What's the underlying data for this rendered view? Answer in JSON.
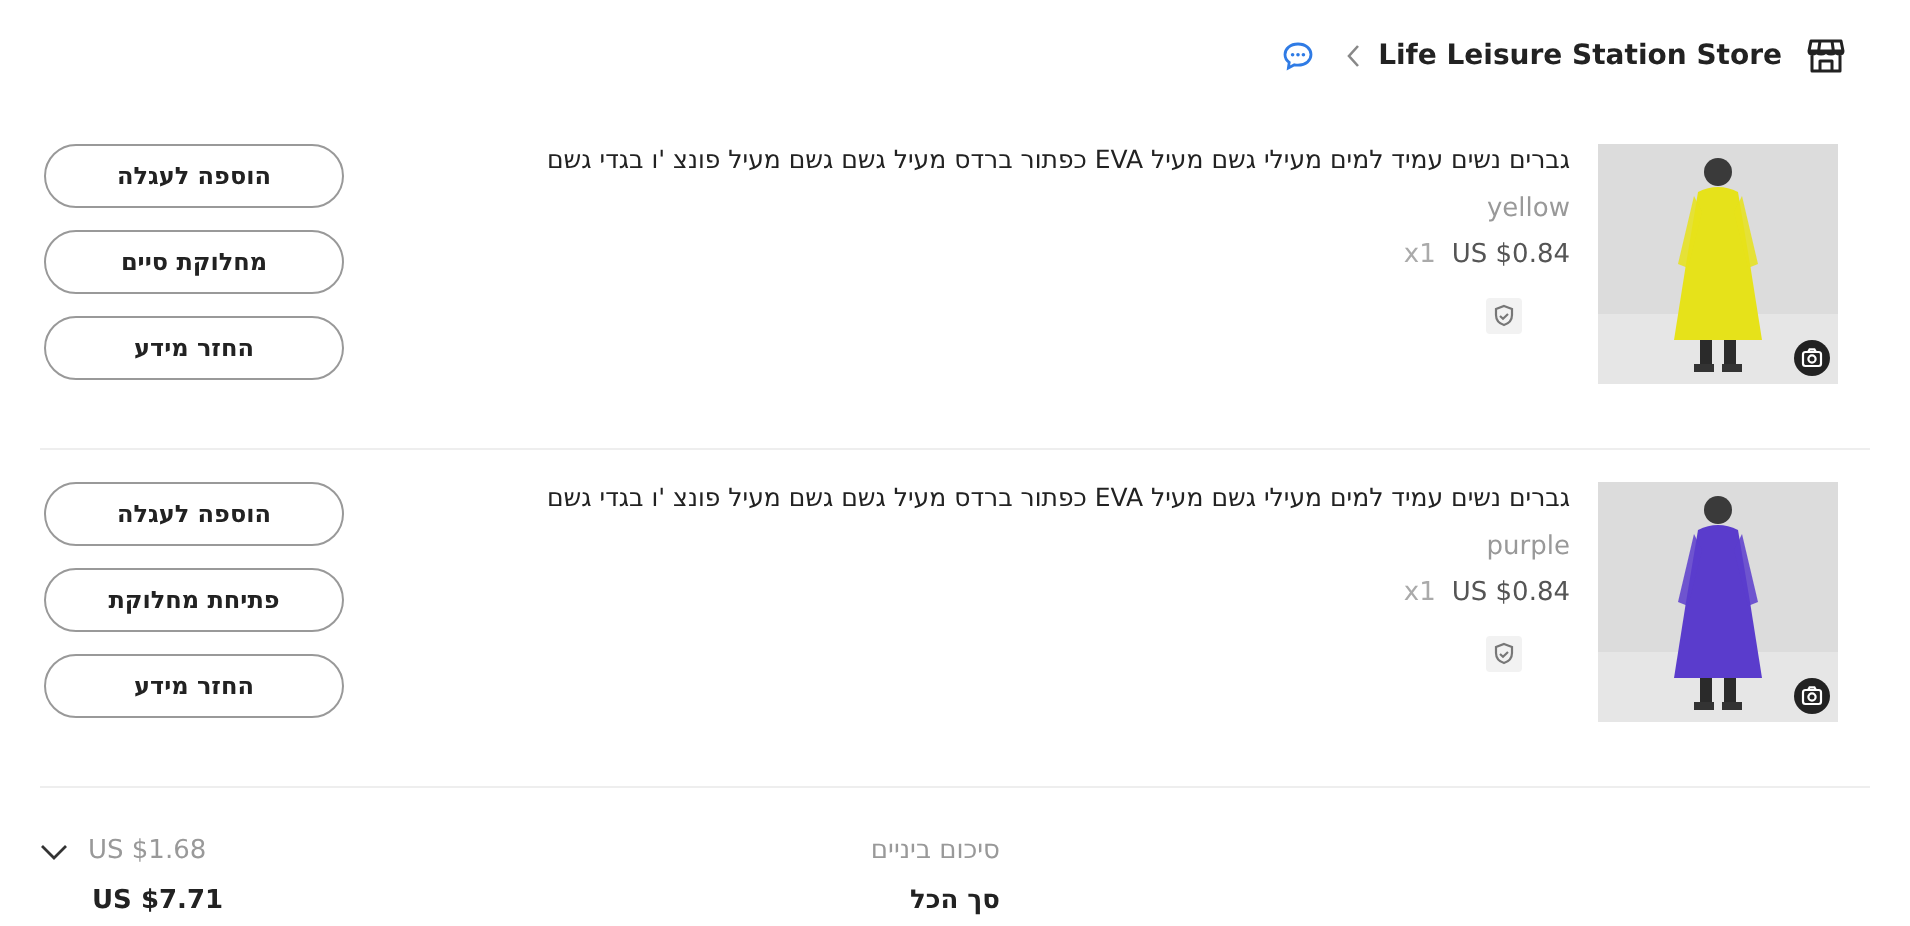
{
  "store": {
    "name": "Life Leisure Station Store"
  },
  "items": [
    {
      "title": "גברים נשים עמיד למים מעילי גשם מעיל EVA כפתור ברדס מעיל גשם גשם מעיל פונצ 'ו בגדי גשם",
      "variant": "yellow",
      "quantity": "x1",
      "price": "US $0.84",
      "buttons": [
        "הוספה לעגלה",
        "מחלוקת סיים",
        "החזר מידע"
      ]
    },
    {
      "title": "גברים נשים עמיד למים מעילי גשם מעיל EVA כפתור ברדס מעיל גשם גשם מעיל פונצ 'ו בגדי גשם",
      "variant": "purple",
      "quantity": "x1",
      "price": "US $0.84",
      "buttons": [
        "הוספה לעגלה",
        "פתיחת מחלוקת",
        "החזר מידע"
      ]
    }
  ],
  "summary": {
    "subtotal_label": "סיכום ביניים",
    "subtotal": "US $1.68",
    "total_label": "סך הכל",
    "total": "US $7.71",
    "expanded": false
  }
}
